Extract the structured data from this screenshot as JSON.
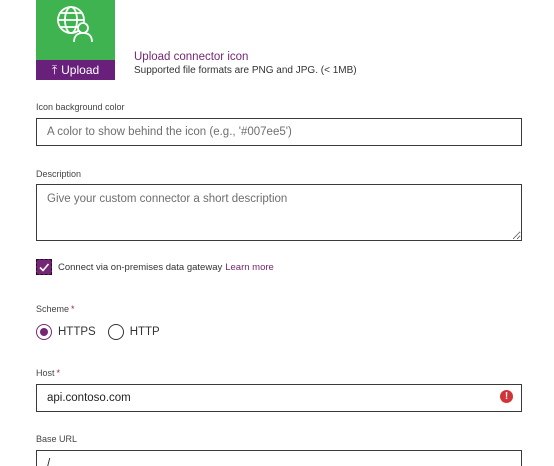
{
  "upload": {
    "button_label": "Upload",
    "link_text": "Upload connector icon",
    "hint": "Supported file formats are PNG and JPG. (< 1MB)"
  },
  "icon_background": {
    "label": "Icon background color",
    "placeholder": "A color to show behind the icon (e.g., '#007ee5')",
    "value": ""
  },
  "description": {
    "label": "Description",
    "placeholder": "Give your custom connector a short description",
    "value": ""
  },
  "gateway": {
    "label": "Connect via on-premises data gateway",
    "learn_more": "Learn more",
    "checked": true
  },
  "scheme": {
    "label": "Scheme",
    "required_mark": "*",
    "options": [
      "HTTPS",
      "HTTP"
    ],
    "selected": "HTTPS"
  },
  "host": {
    "label": "Host",
    "required_mark": "*",
    "value": "api.contoso.com",
    "error_glyph": "!"
  },
  "base_url": {
    "label": "Base URL",
    "value": "/"
  },
  "colors": {
    "accent": "#742774",
    "icon_tile": "#3eb34f",
    "error": "#d13438"
  }
}
